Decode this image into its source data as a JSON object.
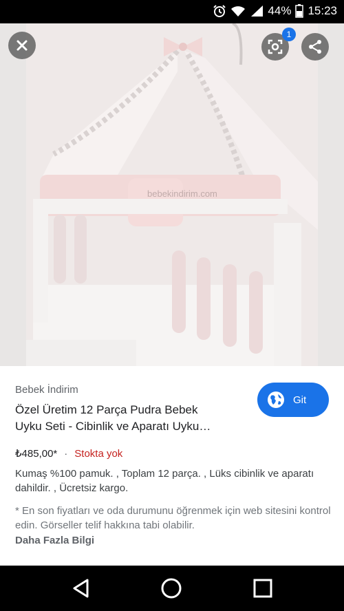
{
  "status_bar": {
    "battery": "44%",
    "time": "15:23"
  },
  "image_overlay": {
    "lens_badge_count": "1",
    "watermark": "bebekindirim.com"
  },
  "result": {
    "source": "Bebek İndirim",
    "title_line1": "Özel Üretim 12 Parça Pudra Bebek",
    "title_line2": "Uyku Seti - Cibinlik ve Aparatı Uyku…",
    "go_label": "Git",
    "price": "₺485,00*",
    "separator": "·",
    "stock_status": "Stokta yok",
    "description": "Kumaş %100 pamuk. , Toplam 12 parça. , Lüks cibinlik ve aparatı dahildir. , Ücretsiz kargo.",
    "note": "* En son fiyatları ve oda durumunu öğrenmek için web sitesini kontrol edin. Görseller telif hakkına tabi olabilir.",
    "more_info": "Daha Fazla Bilgi"
  },
  "colors": {
    "accent": "#1a73e8",
    "out_of_stock": "#c5221f"
  }
}
